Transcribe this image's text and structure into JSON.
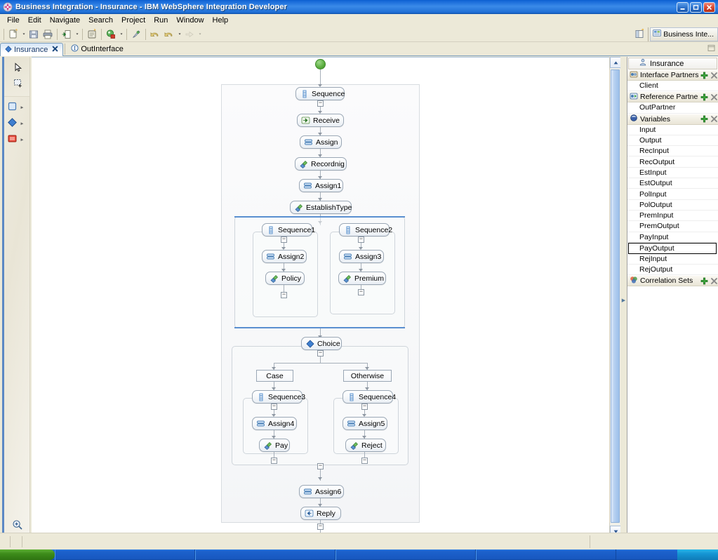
{
  "window": {
    "title": "Business Integration - Insurance - IBM WebSphere Integration Developer",
    "icon": "app-icon",
    "minimize": "_",
    "maximize": "❐",
    "close": "✕"
  },
  "menubar": {
    "items": [
      "File",
      "Edit",
      "Navigate",
      "Search",
      "Project",
      "Run",
      "Window",
      "Help"
    ]
  },
  "toolbar": {
    "groups": [
      {
        "buttons": [
          {
            "name": "new-wizard-icon",
            "dropdown": true
          },
          {
            "name": "save-icon",
            "dropdown": false
          },
          {
            "name": "print-icon",
            "dropdown": false
          }
        ]
      },
      {
        "buttons": [
          {
            "name": "export-icon",
            "dropdown": true
          }
        ]
      },
      {
        "buttons": [
          {
            "name": "build-icon",
            "dropdown": false
          }
        ]
      },
      {
        "buttons": [
          {
            "name": "debug-icon",
            "dropdown": true
          }
        ]
      },
      {
        "buttons": [
          {
            "name": "run-icon",
            "dropdown": false
          }
        ]
      },
      {
        "buttons": [
          {
            "name": "undo-icon",
            "dropdown": false
          },
          {
            "name": "redo-icon",
            "dropdown": true
          },
          {
            "name": "forward-icon",
            "dropdown": true
          }
        ]
      }
    ],
    "open_perspective": "open-perspective-icon",
    "perspective_label": "Business Inte..."
  },
  "editor_tabs": [
    {
      "label": "Insurance",
      "icon": "process-diamond-icon",
      "active": true,
      "closable": true
    },
    {
      "label": "OutInterface",
      "icon": "interface-icon",
      "active": false,
      "closable": false
    }
  ],
  "palette": {
    "tools": [
      {
        "name": "select-tool",
        "icon": "arrow-cursor-icon"
      },
      {
        "name": "marquee-tool",
        "icon": "marquee-icon"
      }
    ],
    "drawers": [
      {
        "name": "basic-actions-drawer",
        "icon": "square-blue-icon"
      },
      {
        "name": "structures-drawer",
        "icon": "diamond-blue-icon"
      },
      {
        "name": "faults-drawer",
        "icon": "square-red-icon"
      }
    ],
    "zoom": [
      {
        "name": "zoom-in-tool",
        "icon": "zoom-in-icon"
      },
      {
        "name": "zoom-out-tool",
        "icon": "zoom-out-icon"
      }
    ]
  },
  "outline": {
    "title": "Insurance",
    "title_icon": "process-icon",
    "add_icon": "add-green-plus-icon",
    "delete_icon": "delete-x-icon",
    "sections": [
      {
        "label": "Interface Partners",
        "icon": "interface-partners-icon",
        "has_actions": true,
        "items": [
          "Client"
        ]
      },
      {
        "label": "Reference Partners",
        "icon": "reference-partners-icon",
        "has_actions": true,
        "items": [
          "OutPartner"
        ]
      },
      {
        "label": "Variables",
        "icon": "variables-icon",
        "has_actions": true,
        "items": [
          "Input",
          "Output",
          "RecInput",
          "RecOutput",
          "EstInput",
          "EstOutput",
          "PolInput",
          "PolOutput",
          "PremInput",
          "PremOutput",
          "PayInput",
          "PayOutput",
          "RejInput",
          "RejOutput"
        ],
        "selected_item": "PayOutput"
      },
      {
        "label": "Correlation Sets",
        "icon": "correlation-sets-icon",
        "has_actions": true,
        "items": []
      }
    ]
  },
  "diagram": {
    "start_node": {
      "name": "start-terminal",
      "icon": "green-circle-icon"
    },
    "end_node": {
      "name": "end-terminal",
      "icon": "blue-circle-icon"
    },
    "nodes": [
      {
        "id": "sequence",
        "label": "Sequence",
        "icon": "sequence-icon"
      },
      {
        "id": "receive",
        "label": "Receive",
        "icon": "receive-icon"
      },
      {
        "id": "assign",
        "label": "Assign",
        "icon": "assign-icon"
      },
      {
        "id": "recordnig",
        "label": "Recordnig",
        "icon": "invoke-icon"
      },
      {
        "id": "assign1",
        "label": "Assign1",
        "icon": "assign-icon"
      },
      {
        "id": "establishtype",
        "label": "EstablishType",
        "icon": "invoke-icon"
      },
      {
        "id": "sequence1",
        "label": "Sequence1",
        "icon": "sequence-icon"
      },
      {
        "id": "assign2",
        "label": "Assign2",
        "icon": "assign-icon"
      },
      {
        "id": "policy",
        "label": "Policy",
        "icon": "invoke-icon"
      },
      {
        "id": "sequence2",
        "label": "Sequence2",
        "icon": "sequence-icon"
      },
      {
        "id": "assign3",
        "label": "Assign3",
        "icon": "assign-icon"
      },
      {
        "id": "premium",
        "label": "Premium",
        "icon": "invoke-icon"
      },
      {
        "id": "choice",
        "label": "Choice",
        "icon": "choice-diamond-icon"
      },
      {
        "id": "case",
        "label": "Case",
        "icon": "none"
      },
      {
        "id": "otherwise",
        "label": "Otherwise",
        "icon": "none"
      },
      {
        "id": "sequence3",
        "label": "Sequence3",
        "icon": "sequence-icon"
      },
      {
        "id": "assign4",
        "label": "Assign4",
        "icon": "assign-icon"
      },
      {
        "id": "pay",
        "label": "Pay",
        "icon": "invoke-icon"
      },
      {
        "id": "sequence4",
        "label": "Sequence4",
        "icon": "sequence-icon"
      },
      {
        "id": "assign5",
        "label": "Assign5",
        "icon": "assign-icon"
      },
      {
        "id": "reject",
        "label": "Reject",
        "icon": "invoke-icon"
      },
      {
        "id": "assign6",
        "label": "Assign6",
        "icon": "assign-icon"
      },
      {
        "id": "reply",
        "label": "Reply",
        "icon": "reply-icon"
      }
    ]
  },
  "statusbar": {
    "text": ""
  },
  "colors": {
    "title_blue": "#1668d8",
    "accent_blue": "#5a8fd0",
    "node_border": "#9aa7b5",
    "start_green": "#5aac3e",
    "end_blue": "#2f6fb8",
    "selection_border": "#000000"
  }
}
